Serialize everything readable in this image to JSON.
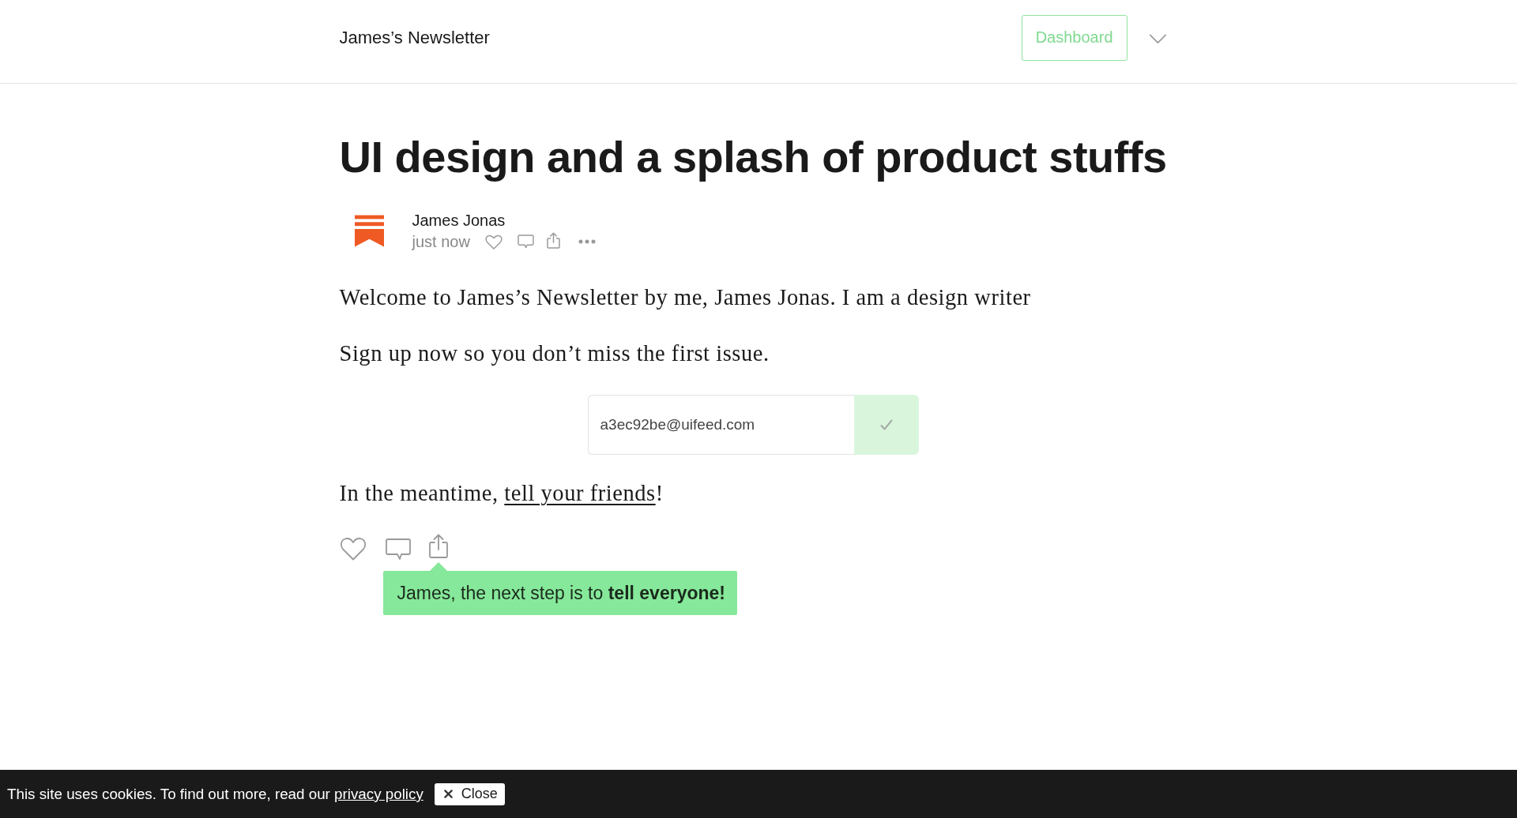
{
  "header": {
    "title": "James’s Newsletter",
    "button": "Dashboard"
  },
  "post": {
    "title": "UI design and a splash of product stuffs",
    "author": {
      "name": "James Jonas",
      "time": "just now"
    },
    "paragraphs": [
      "Welcome to James’s Newsletter by me, James Jonas. I am a design writer",
      "Sign up now so you don’t miss the first issue."
    ],
    "signup": {
      "value": "a3ec92be@uifeed.com"
    },
    "closing": {
      "text_before": "In the meantime, ",
      "link": "tell your friends",
      "text_after": "!"
    }
  },
  "tooltip": {
    "text": "James, the next step is to **tell everyone!**"
  },
  "cookie_bar": {
    "text": "This site uses cookies. To find out more, read our ",
    "link": "privacy policy",
    "close_button": "Close"
  }
}
